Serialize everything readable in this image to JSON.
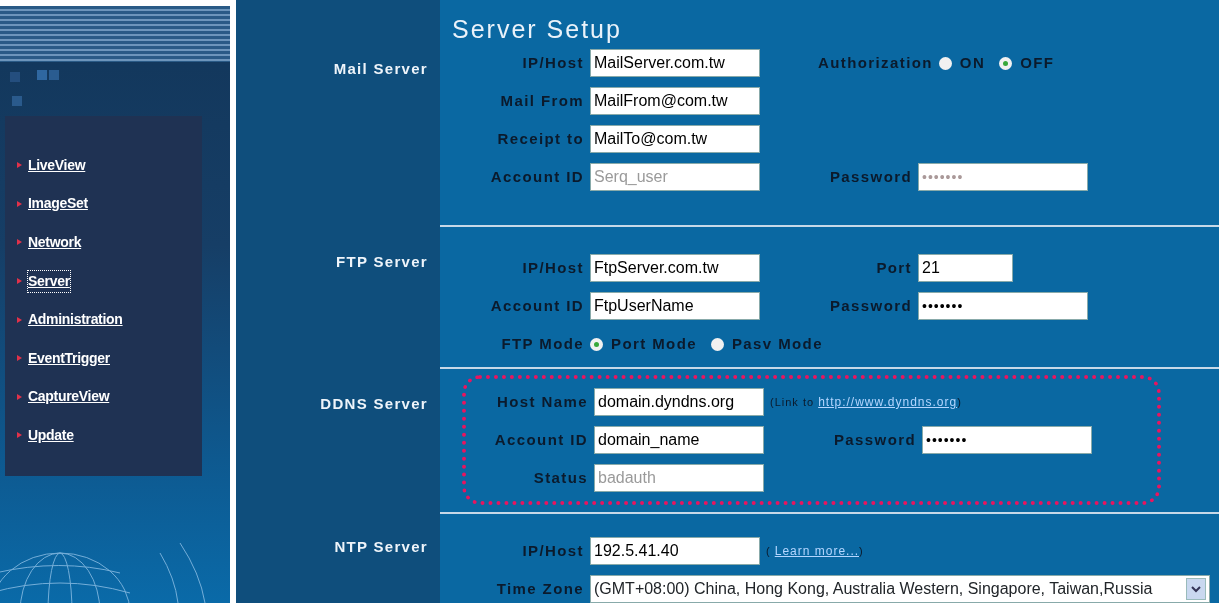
{
  "sidebar": {
    "items": [
      {
        "label": "LiveView",
        "selected": false
      },
      {
        "label": "ImageSet",
        "selected": false
      },
      {
        "label": "Network",
        "selected": false
      },
      {
        "label": "Server",
        "selected": true
      },
      {
        "label": "Administration",
        "selected": false
      },
      {
        "label": "EventTrigger",
        "selected": false
      },
      {
        "label": "CaptureView",
        "selected": false
      },
      {
        "label": "Update",
        "selected": false
      }
    ]
  },
  "page_title": "Server Setup",
  "sections": [
    {
      "title": "Mail Server",
      "highlighted": false,
      "rows": [
        [
          {
            "kind": "field",
            "label": "IP/Host",
            "value": "MailServer.com.tw",
            "disabled": false
          },
          {
            "kind": "radio",
            "label": "Authorization",
            "options": [
              {
                "label": "ON",
                "selected": false
              },
              {
                "label": "OFF",
                "selected": true
              }
            ]
          }
        ],
        [
          {
            "kind": "field",
            "label": "Mail From",
            "value": "MailFrom@com.tw",
            "disabled": false
          }
        ],
        [
          {
            "kind": "field",
            "label": "Receipt to",
            "value": "MailTo@com.tw",
            "disabled": false
          }
        ],
        [
          {
            "kind": "field",
            "label": "Account ID",
            "value": "Serq_user",
            "disabled": true
          },
          {
            "kind": "password",
            "label": "Password",
            "value": "•••••••",
            "disabled": true
          }
        ]
      ]
    },
    {
      "title": "FTP Server",
      "highlighted": false,
      "rows": [
        [
          {
            "kind": "field",
            "label": "IP/Host",
            "value": "FtpServer.com.tw",
            "disabled": false
          },
          {
            "kind": "short",
            "label": "Port",
            "value": "21",
            "disabled": false
          }
        ],
        [
          {
            "kind": "field",
            "label": "Account ID",
            "value": "FtpUserName",
            "disabled": false
          },
          {
            "kind": "password",
            "label": "Password",
            "value": "•••••••",
            "disabled": false
          }
        ],
        [
          {
            "kind": "radio",
            "label": "FTP Mode",
            "options": [
              {
                "label": "Port Mode",
                "selected": true
              },
              {
                "label": "Pasv Mode",
                "selected": false
              }
            ]
          }
        ]
      ]
    },
    {
      "title": "DDNS Server",
      "highlighted": true,
      "rows": [
        [
          {
            "kind": "field",
            "label": "Host Name",
            "value": "domain.dyndns.org",
            "disabled": false
          },
          {
            "kind": "note",
            "before": "(Link to",
            "link": "http://www.dyndns.org",
            "after": ")"
          }
        ],
        [
          {
            "kind": "field",
            "label": "Account ID",
            "value": "domain_name",
            "disabled": false
          },
          {
            "kind": "password",
            "label": "Password",
            "value": "•••••••",
            "disabled": false
          }
        ],
        [
          {
            "kind": "field",
            "label": "Status",
            "value": "badauth",
            "disabled": true
          }
        ]
      ]
    },
    {
      "title": "NTP Server",
      "highlighted": false,
      "rows": [
        [
          {
            "kind": "field",
            "label": "IP/Host",
            "value": "192.5.41.40",
            "disabled": false
          },
          {
            "kind": "note",
            "before": "(",
            "link": "Learn more...",
            "after": ")"
          }
        ],
        [
          {
            "kind": "select",
            "label": "Time Zone",
            "value": "(GMT+08:00) China, Hong Kong, Australia Western, Singapore, Taiwan,Russia"
          }
        ]
      ]
    }
  ]
}
